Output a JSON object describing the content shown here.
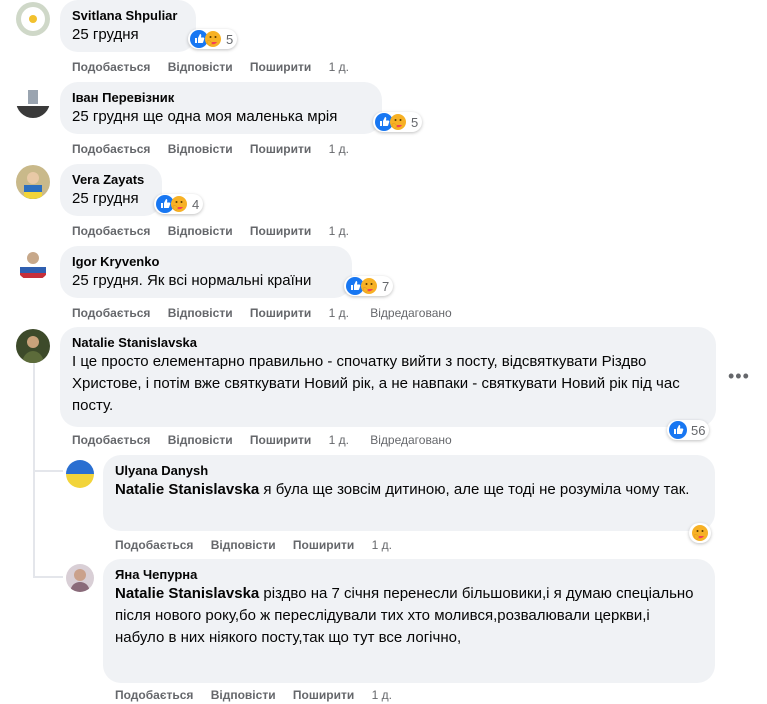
{
  "colors": {
    "bubble": "#f0f2f5",
    "meta": "#65676b",
    "like_blue": "#1877f2",
    "care_yellow": "#f7b125"
  },
  "action_labels": {
    "like": "Подобається",
    "reply": "Відповісти",
    "share": "Поширити"
  },
  "comments": [
    {
      "author": "Svitlana Shpuliar",
      "text": "25 грудня",
      "time": "1 д.",
      "reactions": {
        "icons": [
          "like-icon",
          "care-icon"
        ],
        "count": "5"
      }
    },
    {
      "author": "Іван Перевізник",
      "text": "25 грудня ще одна моя маленька мрія",
      "time": "1 д.",
      "reactions": {
        "icons": [
          "like-icon",
          "care-icon"
        ],
        "count": "5"
      }
    },
    {
      "author": "Vera Zayats",
      "text": "25 грудня",
      "time": "1 д.",
      "reactions": {
        "icons": [
          "like-icon",
          "care-icon"
        ],
        "count": "4"
      }
    },
    {
      "author": "Igor Kryvenko",
      "text": "25 грудня. Як всі нормальні країни",
      "time": "1 д.",
      "edited": "Відредаговано",
      "reactions": {
        "icons": [
          "like-icon",
          "care-icon"
        ],
        "count": "7"
      }
    },
    {
      "author": "Natalie Stanislavska",
      "text": "І це просто елементарно правильно - спочатку вийти з посту, відсвяткувати Різдво Христове, і потім вже святкувати Новий рік, а не навпаки - святкувати Новий рік під час посту.",
      "time": "1 д.",
      "edited": "Відредаговано",
      "reactions": {
        "icons": [
          "like-icon"
        ],
        "count": "56"
      },
      "more": "•••"
    }
  ],
  "replies": [
    {
      "author": "Ulyana Danysh",
      "mention": "Natalie Stanislavska",
      "text": " я була ще зовсім дитиною, але ще тоді не розуміла чому так.",
      "time": "1 д.",
      "reactions": {
        "icons": [
          "care-icon"
        ]
      }
    },
    {
      "author": "Яна Чепурна",
      "mention": "Natalie Stanislavska",
      "text": " різдво на 7 січня перенесли більшовики,і я думаю спеціально після нового року,бо ж переслідували тих хто молився,розвалювали церкви,і набуло в них ніякого посту,так що тут все логічно,",
      "time": "1 д."
    }
  ]
}
